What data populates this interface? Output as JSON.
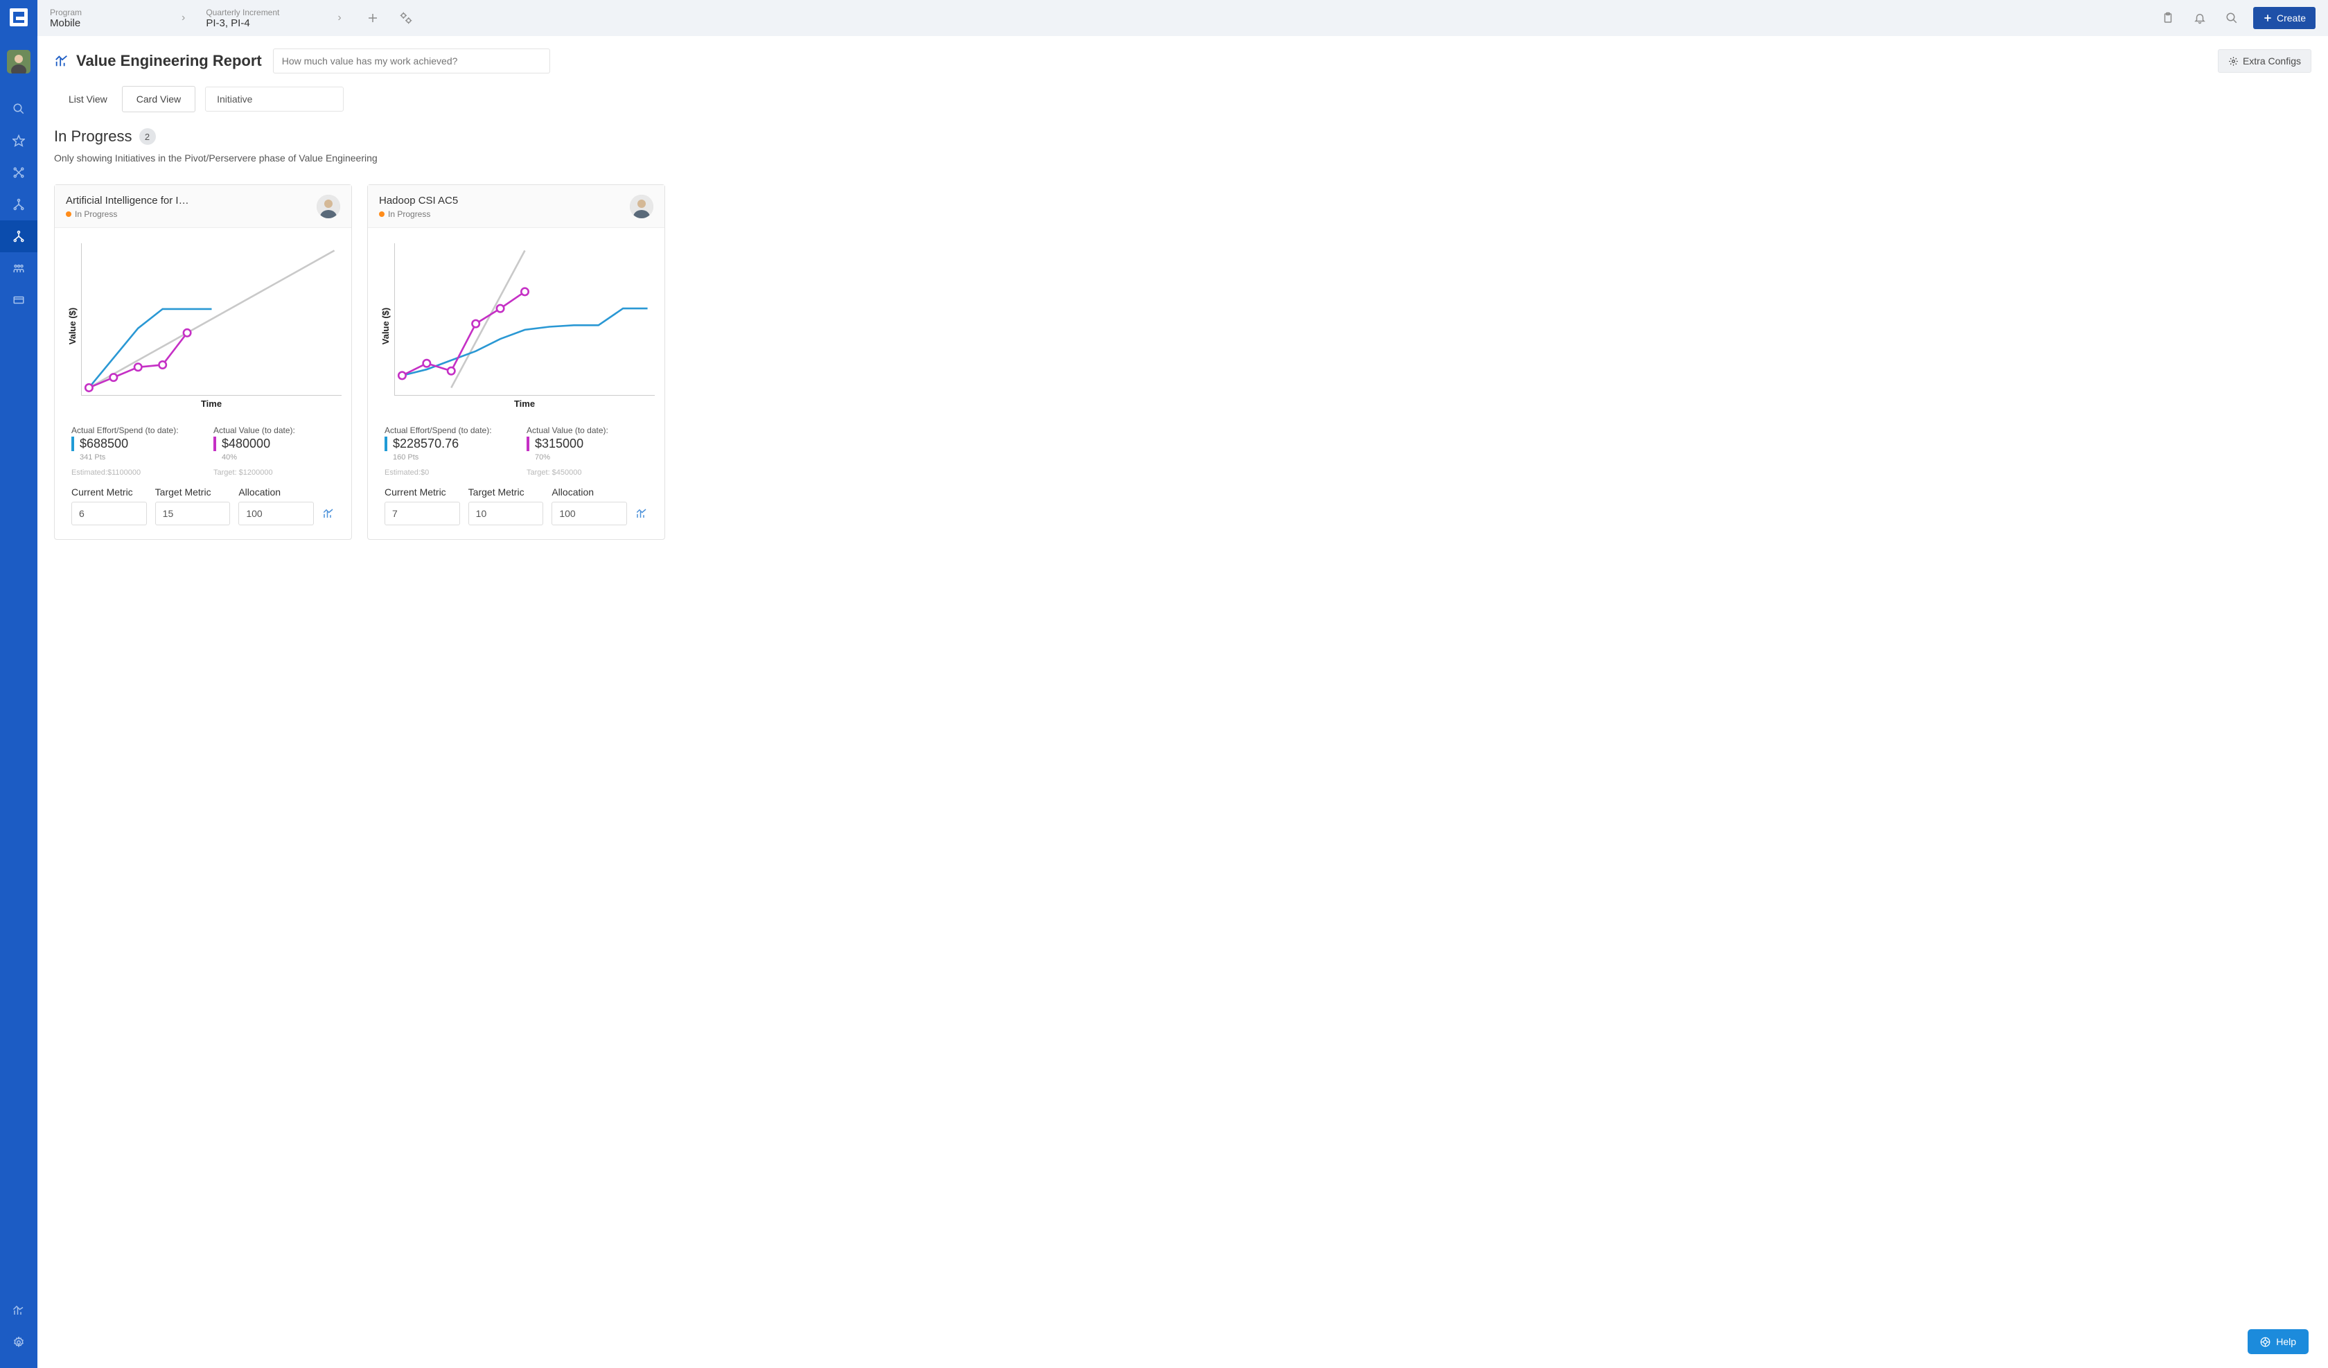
{
  "breadcrumb": {
    "program_label": "Program",
    "program_value": "Mobile",
    "increment_label": "Quarterly Increment",
    "increment_value": "PI-3, PI-4"
  },
  "create_label": "Create",
  "page_title": "Value Engineering Report",
  "search_placeholder": "How much value has my work achieved?",
  "extra_configs_label": "Extra Configs",
  "tabs": {
    "list": "List View",
    "card": "Card View",
    "dropdown": "Initiative"
  },
  "section": {
    "title": "In Progress",
    "count": "2",
    "subtitle": "Only showing Initiatives in the Pivot/Perservere phase of Value Engineering"
  },
  "chart_axis": {
    "y": "Value ($)",
    "x": "Time"
  },
  "metric_labels": {
    "effort": "Actual Effort/Spend (to date):",
    "value": "Actual Value (to date):",
    "current": "Current Metric",
    "target": "Target Metric",
    "allocation": "Allocation"
  },
  "cards": [
    {
      "title": "Artificial Intelligence for I…",
      "status": "In Progress",
      "effort_value": "$688500",
      "effort_sub": "341 Pts",
      "value_value": "$480000",
      "value_sub": "40%",
      "estimated": "Estimated:$1100000",
      "target_full": "Target: $1200000",
      "current_metric": "6",
      "target_metric": "15",
      "allocation": "100"
    },
    {
      "title": "Hadoop CSI AC5",
      "status": "In Progress",
      "effort_value": "$228570.76",
      "effort_sub": "160 Pts",
      "value_value": "$315000",
      "value_sub": "70%",
      "estimated": "Estimated:$0",
      "target_full": "Target: $450000",
      "current_metric": "7",
      "target_metric": "10",
      "allocation": "100"
    }
  ],
  "help_label": "Help",
  "chart_data": [
    {
      "type": "line",
      "title": "Artificial Intelligence for I…",
      "xlabel": "Time",
      "ylabel": "Value ($)",
      "ylim": [
        0,
        1200000
      ],
      "series": [
        {
          "name": "Target (grey)",
          "color": "#c9c9c9",
          "x": [
            0,
            10
          ],
          "values": [
            0,
            1200000
          ]
        },
        {
          "name": "Actual Spend (blue)",
          "color": "#2a98d4",
          "x": [
            0,
            1,
            2,
            3,
            4,
            5
          ],
          "values": [
            0,
            260000,
            520000,
            688500,
            688500,
            688500
          ],
          "markers": false
        },
        {
          "name": "Actual Value (magenta)",
          "color": "#c530c5",
          "x": [
            0,
            1,
            2,
            3,
            4
          ],
          "values": [
            0,
            90000,
            180000,
            200000,
            480000
          ],
          "markers": true
        }
      ]
    },
    {
      "type": "line",
      "title": "Hadoop CSI AC5",
      "xlabel": "Time",
      "ylabel": "Value ($)",
      "ylim": [
        0,
        450000
      ],
      "series": [
        {
          "name": "Target (grey)",
          "color": "#c9c9c9",
          "x": [
            2,
            5
          ],
          "values": [
            0,
            450000
          ]
        },
        {
          "name": "Actual Spend (blue)",
          "color": "#2a98d4",
          "x": [
            0,
            1,
            2,
            3,
            4,
            5,
            6,
            7,
            8,
            9,
            10
          ],
          "values": [
            40000,
            60000,
            90000,
            120000,
            160000,
            190000,
            200000,
            205000,
            205000,
            260000,
            260000
          ],
          "markers": false
        },
        {
          "name": "Actual Value (magenta)",
          "color": "#c530c5",
          "x": [
            0,
            1,
            2,
            3,
            4,
            5
          ],
          "values": [
            40000,
            80000,
            55000,
            210000,
            260000,
            315000
          ],
          "markers": true
        }
      ]
    }
  ]
}
